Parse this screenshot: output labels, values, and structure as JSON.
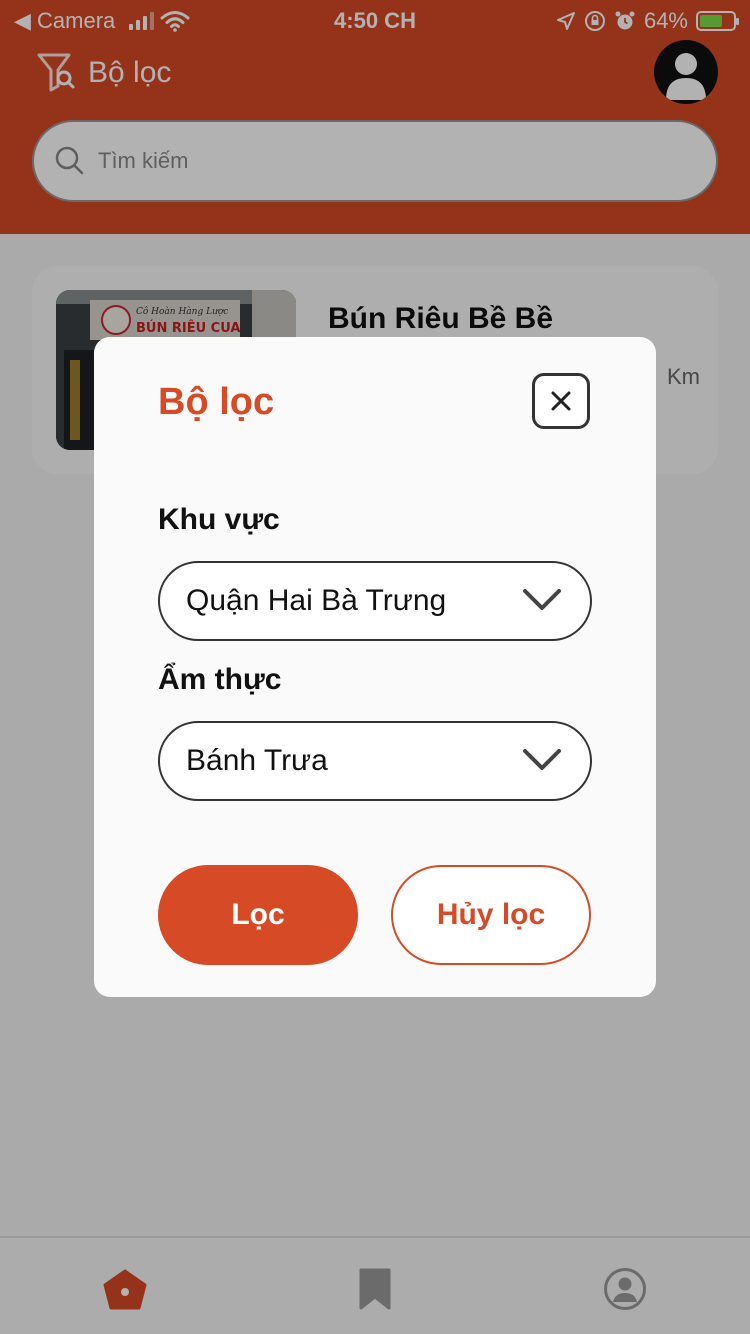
{
  "status_bar": {
    "back_label": "◀ Camera",
    "time": "4:50 CH",
    "battery": "64%"
  },
  "header": {
    "title": "Bộ lọc",
    "search_placeholder": "Tìm kiếm"
  },
  "list": {
    "items": [
      {
        "title": "Bún Riêu Bề Bề",
        "distance_unit": "Km",
        "sign_top": "Cô Hoàn Hàng Lược",
        "sign_main": "BÚN RIÊU CUA"
      }
    ]
  },
  "modal": {
    "title": "Bộ lọc",
    "fields": [
      {
        "label": "Khu vực",
        "value": "Quận Hai Bà Trưng"
      },
      {
        "label": "Ẩm thực",
        "value": "Bánh Trưa"
      }
    ],
    "apply_label": "Lọc",
    "cancel_label": "Hủy lọc"
  },
  "colors": {
    "brand": "#d64a26",
    "nav_inactive": "#9a9a9a"
  },
  "icons": [
    "filter-icon",
    "search-icon",
    "avatar-icon",
    "close-icon",
    "chevron-down-icon",
    "home-icon",
    "bookmark-icon",
    "profile-icon"
  ]
}
